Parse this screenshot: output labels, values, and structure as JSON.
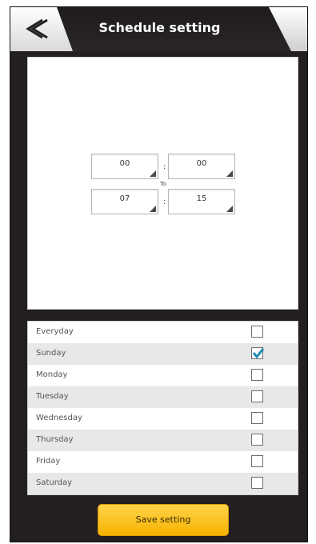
{
  "header": {
    "title": "Schedule setting",
    "back_icon": "back-chevron-icon"
  },
  "time": {
    "start_hour": "00",
    "start_minute": "00",
    "separator": ":",
    "to_label": "To",
    "end_hour": "07",
    "end_minute": "15"
  },
  "days": [
    {
      "label": "Everyday",
      "checked": false
    },
    {
      "label": "Sunday",
      "checked": true
    },
    {
      "label": "Monday",
      "checked": false
    },
    {
      "label": "Tuesday",
      "checked": false
    },
    {
      "label": "Wednesday",
      "checked": false
    },
    {
      "label": "Thursday",
      "checked": false
    },
    {
      "label": "Friday",
      "checked": false
    },
    {
      "label": "Saturday",
      "checked": false
    }
  ],
  "save_button": {
    "label": "Save setting"
  },
  "colors": {
    "check": "#1a8ab4",
    "accent": "#f9bd0c",
    "background": "#231f20"
  }
}
